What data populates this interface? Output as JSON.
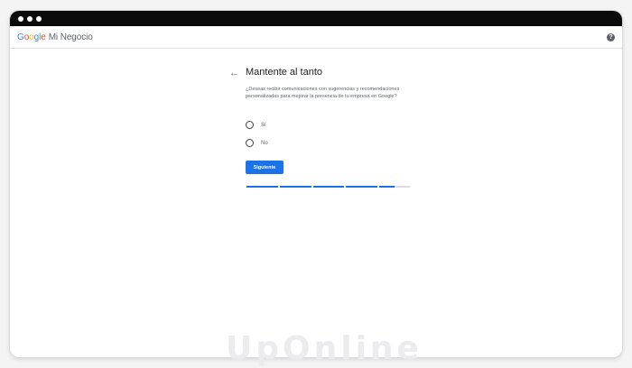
{
  "window": {
    "controls": [
      "close",
      "minimize",
      "maximize"
    ]
  },
  "appbar": {
    "brand_letters": [
      "G",
      "o",
      "o",
      "g",
      "l",
      "e"
    ],
    "product": "Mi Negocio",
    "help_icon": "help-circle-icon"
  },
  "main": {
    "back_icon": "arrow-left-icon",
    "title": "Mantente al tanto",
    "description": "¿Deseas recibir comunicaciones con sugerencias y recomendaciones personalizadas para mejorar la presencia de tu empresa en Google?",
    "options": [
      {
        "label": "Sí",
        "selected": false
      },
      {
        "label": "No",
        "selected": false
      }
    ],
    "next_label": "Siguiente",
    "accent_color": "#1a73e8",
    "progress": {
      "completed_steps": 4,
      "current_step_fill": 0.5,
      "total_steps": 5
    }
  },
  "watermark": "UpOnline"
}
